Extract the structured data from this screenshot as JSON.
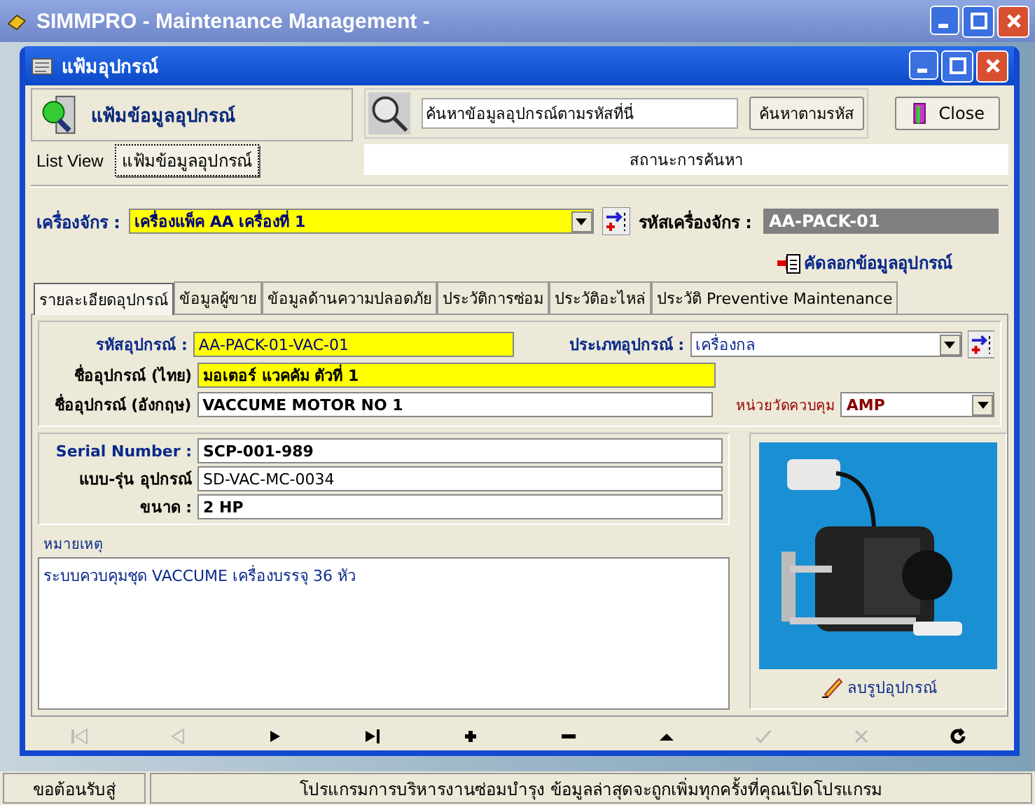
{
  "app_window": {
    "title": "SIMMPRO - Maintenance Management -"
  },
  "window": {
    "title": "แฟ้มอุปกรณ์"
  },
  "header": {
    "title": "แฟ้มข้อมูลอุปกรณ์",
    "search_value": "ค้นหาข้อมูลอุปกรณ์ตามรหัสที่นี่",
    "search_button": "ค้นหาตามรหัส",
    "close_button": "Close",
    "search_status": "สถานะการค้นหา"
  },
  "view_tabs": [
    {
      "label": "List View",
      "selected": false
    },
    {
      "label": "แฟ้มข้อมูลอุปกรณ์",
      "selected": true
    }
  ],
  "machine": {
    "label": "เครื่องจักร :",
    "value": "เครื่องแพ็ค AA เครื่องที่ 1",
    "code_label": "รหัสเครื่องจักร :",
    "code_value": "AA-PACK-01"
  },
  "copy_link": "คัดลอกข้อมูลอุปกรณ์",
  "tabs": [
    {
      "label": "รายละเอียดอุปกรณ์",
      "selected": true
    },
    {
      "label": "ข้อมูลผู้ขาย",
      "selected": false
    },
    {
      "label": "ข้อมูลด้านความปลอดภัย",
      "selected": false
    },
    {
      "label": "ประวัติการซ่อม",
      "selected": false
    },
    {
      "label": "ประวัติอะไหล่",
      "selected": false
    },
    {
      "label": "ประวัติ Preventive Maintenance",
      "selected": false
    }
  ],
  "equipment": {
    "code_label": "รหัสอุปกรณ์ :",
    "code": "AA-PACK-01-VAC-01",
    "type_label": "ประเภทอุปกรณ์ :",
    "type": "เครื่องกล",
    "name_th_label": "ชื่ออุปกรณ์ (ไทย)",
    "name_th": "มอเตอร์ แวคคัม ตัวที่ 1",
    "name_en_label": "ชื่ออุปกรณ์ (อังกฤษ)",
    "name_en": "VACCUME MOTOR NO 1",
    "unit_label": "หน่วยวัดควบคุม",
    "unit": "AMP"
  },
  "specs": [
    {
      "label": "Serial Number :",
      "value": "SCP-001-989",
      "bold": true
    },
    {
      "label": "แบบ-รุ่น อุปกรณ์",
      "value": "SD-VAC-MC-0034",
      "bold": false
    },
    {
      "label": "ขนาด :",
      "value": "2 HP",
      "bold": true
    }
  ],
  "notes": {
    "label": "หมายเหตุ",
    "value": "ระบบควบคุมชุด VACCUME เครื่องบรรจุ 36 หัว"
  },
  "photo": {
    "kind": "picture",
    "delete_button": "ลบรูปอุปกรณ์"
  },
  "nav_buttons": [
    {
      "kind": "first",
      "disabled": true
    },
    {
      "kind": "prev",
      "disabled": true
    },
    {
      "kind": "next",
      "disabled": false
    },
    {
      "kind": "last",
      "disabled": false
    },
    {
      "kind": "add",
      "disabled": false
    },
    {
      "kind": "remove",
      "disabled": false
    },
    {
      "kind": "up",
      "disabled": false
    },
    {
      "kind": "save",
      "disabled": true
    },
    {
      "kind": "cancel",
      "disabled": true
    },
    {
      "kind": "refresh",
      "disabled": false
    }
  ],
  "status_bar": [
    "ขอต้อนรับสู่",
    "โปรแกรมการบริหารงานซ่อมบำรุง   ข้อมูลล่าสุดจะถูกเพิ่มทุกครั้งที่คุณเปิดโปรแกรม"
  ]
}
